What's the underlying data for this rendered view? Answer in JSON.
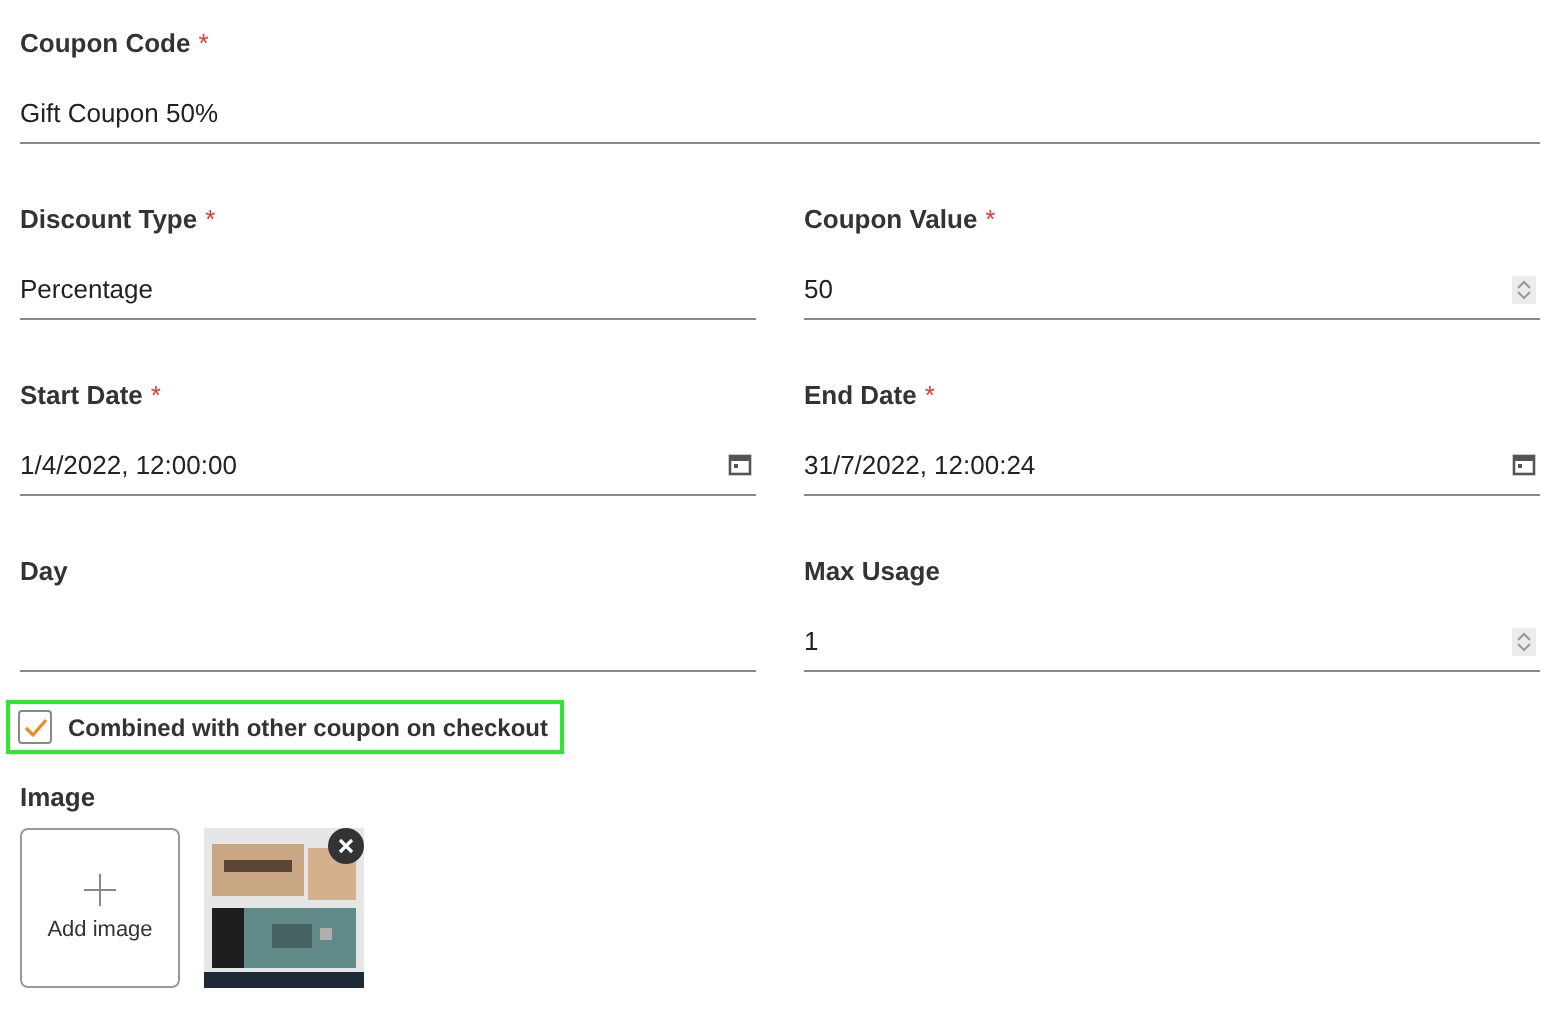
{
  "rows": [
    [
      {
        "label": "Coupon Code",
        "required_mark": "*",
        "value": "Gift Coupon 50%",
        "kind": "text"
      }
    ],
    [
      {
        "label": "Discount Type",
        "required_mark": "*",
        "value": "Percentage",
        "kind": "text"
      },
      {
        "label": "Coupon Value",
        "required_mark": "*",
        "value": "50",
        "kind": "number"
      }
    ],
    [
      {
        "label": "Start Date",
        "required_mark": "*",
        "value": "1/4/2022, 12:00:00",
        "kind": "date"
      },
      {
        "label": "End Date",
        "required_mark": "*",
        "value": "31/7/2022, 12:00:24",
        "kind": "date"
      }
    ],
    [
      {
        "label": "Day",
        "kind": "text"
      },
      {
        "label": "Max Usage",
        "value": "1",
        "kind": "number"
      }
    ]
  ],
  "combine_checkbox": {
    "label": "Combined with other coupon on checkout",
    "checked": true,
    "highlighted": true
  },
  "image": {
    "label": "Image",
    "add_label": "Add image"
  }
}
